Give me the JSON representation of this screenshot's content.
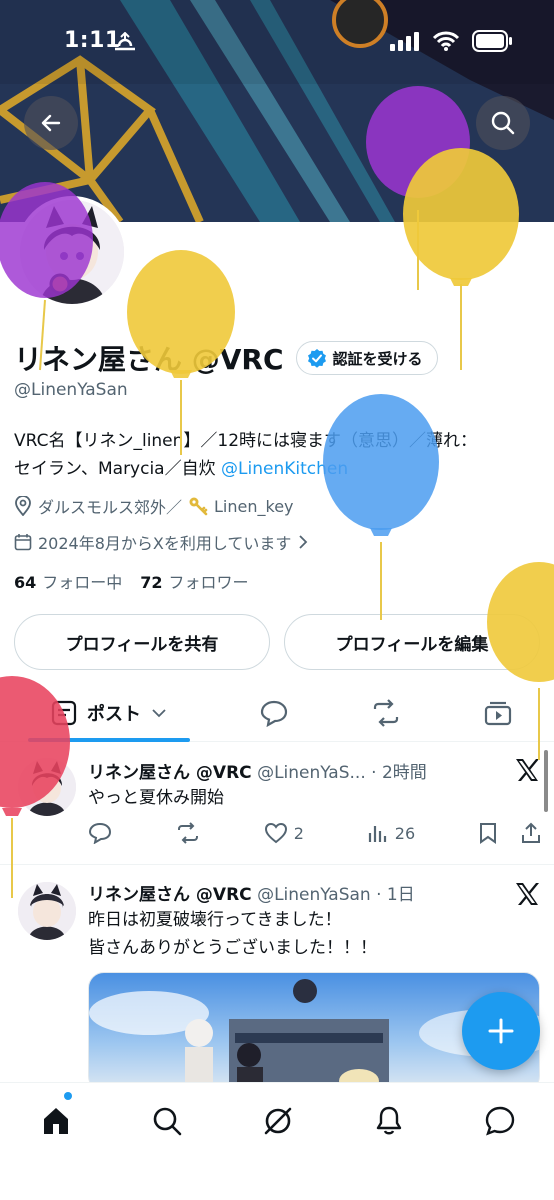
{
  "status_bar": {
    "time": "1:11"
  },
  "profile": {
    "name": "リネン屋さん @VRC",
    "verify_label": "認証を受ける",
    "handle": "@LinenYaSan",
    "bio_line1": "VRC名【リネン_linen】／12時には寝ます（意思）／薄れ：",
    "bio_line2_prefix": "セイラン、Marycia／自炊 ",
    "bio_link": "@LinenKitchen",
    "location": "ダルスモルス郊外／",
    "key_text": "Linen_key",
    "joined": "2024年8月からXを利用しています",
    "following_count": "64",
    "following_label": "フォロー中",
    "followers_count": "72",
    "followers_label": "フォロワー"
  },
  "buttons": {
    "share_profile": "プロフィールを共有",
    "edit_profile": "プロフィールを編集"
  },
  "tabs": {
    "posts_label": "ポスト"
  },
  "posts": [
    {
      "name": "リネン屋さん @VRC",
      "meta": "@LinenYaS... · 2時間",
      "text_lines": [
        "やっと夏休み開始"
      ],
      "likes": "2",
      "views": "26"
    },
    {
      "name": "リネン屋さん @VRC",
      "meta": "@LinenYaSan · 1日",
      "text_lines": [
        "昨日は初夏破壊行ってきました！",
        "皆さんありがとうございました！！！"
      ]
    }
  ],
  "icons": {
    "back": "back-arrow-icon",
    "search": "search-icon",
    "verified": "verified-badge-icon",
    "location": "location-pin-icon",
    "key": "key-icon",
    "calendar": "calendar-icon",
    "compose": "plus-icon"
  },
  "colors": {
    "accent": "#1d9bf0",
    "text": "#0f1419",
    "muted": "#536471"
  }
}
